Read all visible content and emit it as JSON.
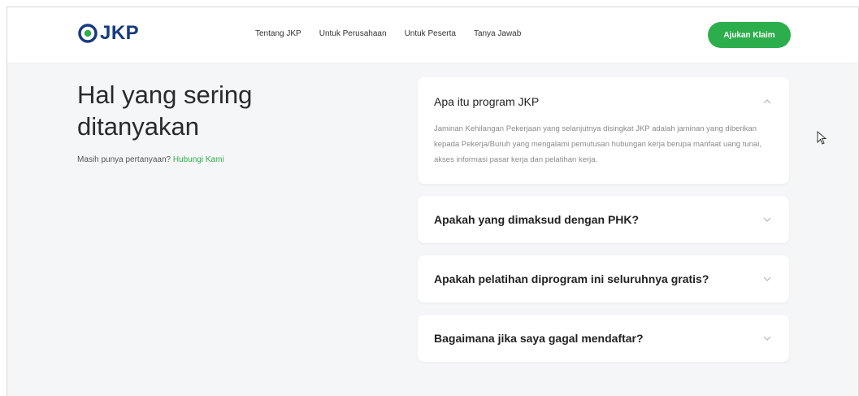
{
  "header": {
    "logo_text": "JKP",
    "nav": [
      "Tentang JKP",
      "Untuk Perusahaan",
      "Untuk Peserta",
      "Tanya Jawab"
    ],
    "cta_label": "Ajukan Klaim"
  },
  "faq": {
    "title": "Hal yang sering ditanyakan",
    "subtitle": "Masih punya pertanyaan?",
    "contact_link": "Hubungi Kami"
  },
  "accordion": [
    {
      "question": "Apa itu program JKP",
      "answer": "Jaminan Kehilangan Pekerjaan yang selanjutnya disingkat JKP adalah jaminan yang diberikan kepada Pekerja/Buruh yang mengalami pemutusan hubungan kerja berupa manfaat uang tunai, akses informasi pasar kerja dan pelatihan kerja.",
      "state": "expanded"
    },
    {
      "question": "Apakah yang dimaksud dengan PHK?",
      "state": "collapsed"
    },
    {
      "question": "Apakah pelatihan diprogram ini seluruhnya gratis?",
      "state": "collapsed"
    },
    {
      "question": "Bagaimana jika saya gagal mendaftar?",
      "state": "collapsed"
    }
  ],
  "colors": {
    "brand_green": "#2cae4c",
    "logo_blue": "#173a80",
    "page_background": "#f5f6f8"
  },
  "icons": [
    "jkp-logo-icon",
    "chevron-up-icon",
    "chevron-down-icon",
    "mouse-cursor-icon"
  ]
}
